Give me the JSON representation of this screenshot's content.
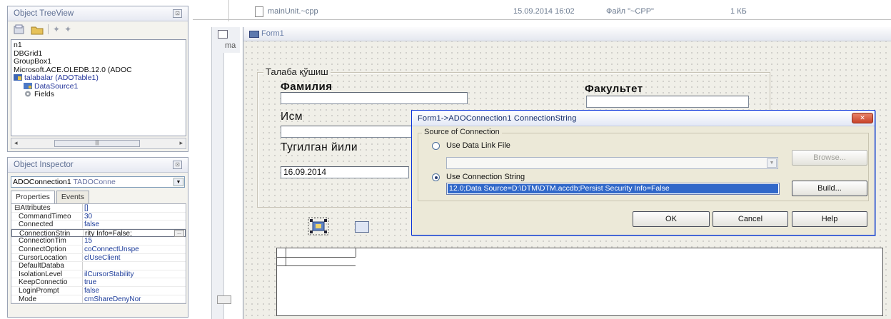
{
  "treeview": {
    "title": "Object TreeView",
    "pin": "⊡",
    "items": [
      {
        "text": "n1"
      },
      {
        "text": "DBGrid1"
      },
      {
        "text": "GroupBox1"
      },
      {
        "text": "Microsoft.ACE.OLEDB.12.0 (ADOC"
      },
      {
        "text": "talabalar (ADOTable1)"
      },
      {
        "text": "DataSource1"
      },
      {
        "text": "Fields"
      }
    ],
    "scroll_thumb": "|||"
  },
  "inspector": {
    "title": "Object Inspector",
    "pin": "⊡",
    "combo_name": "ADOConnection1",
    "combo_type": "TADOConne",
    "tabs": {
      "properties": "Properties",
      "events": "Events"
    },
    "props": [
      {
        "name": "⊟Attributes",
        "value": "[]"
      },
      {
        "name": "CommandTimeo",
        "value": "30"
      },
      {
        "name": "Connected",
        "value": "false"
      },
      {
        "name": "ConnectionStrin",
        "value": "rity Info=False;"
      },
      {
        "name": "ConnectionTim",
        "value": "15"
      },
      {
        "name": "ConnectOption",
        "value": "coConnectUnspe"
      },
      {
        "name": "CursorLocation",
        "value": "clUseClient"
      },
      {
        "name": "DefaultDataba",
        "value": ""
      },
      {
        "name": "IsolationLevel",
        "value": "ilCursorStability"
      },
      {
        "name": "KeepConnectio",
        "value": "true"
      },
      {
        "name": "LoginPrompt",
        "value": "false"
      },
      {
        "name": "Mode",
        "value": "cmShareDenyNor"
      }
    ],
    "ellipsis": "..."
  },
  "filelist": {
    "name": "mainUnit.~cpp",
    "date": "15.09.2014 16:02",
    "type": "Файл \"~CPP\"",
    "size": "1 КБ"
  },
  "editor": {
    "tab": "ma"
  },
  "form": {
    "title": "Form1",
    "group_caption": "Талаба қўшиш",
    "labels": {
      "surname": "Фамилия",
      "faculty": "Факультет",
      "name": "Исм",
      "birth_year": "Тугилган йили"
    },
    "date_value": "16.09.2014"
  },
  "dialog": {
    "title": "Form1->ADOConnection1 ConnectionString",
    "close": "✕",
    "group": "Source of Connection",
    "radio1": "Use Data Link File",
    "radio2": "Use Connection String",
    "conn_value": "12.0;Data Source=D:\\DTM\\DTM.accdb;Persist Security Info=False",
    "browse": "Browse...",
    "build": "Build...",
    "ok": "OK",
    "cancel": "Cancel",
    "help": "Help"
  }
}
